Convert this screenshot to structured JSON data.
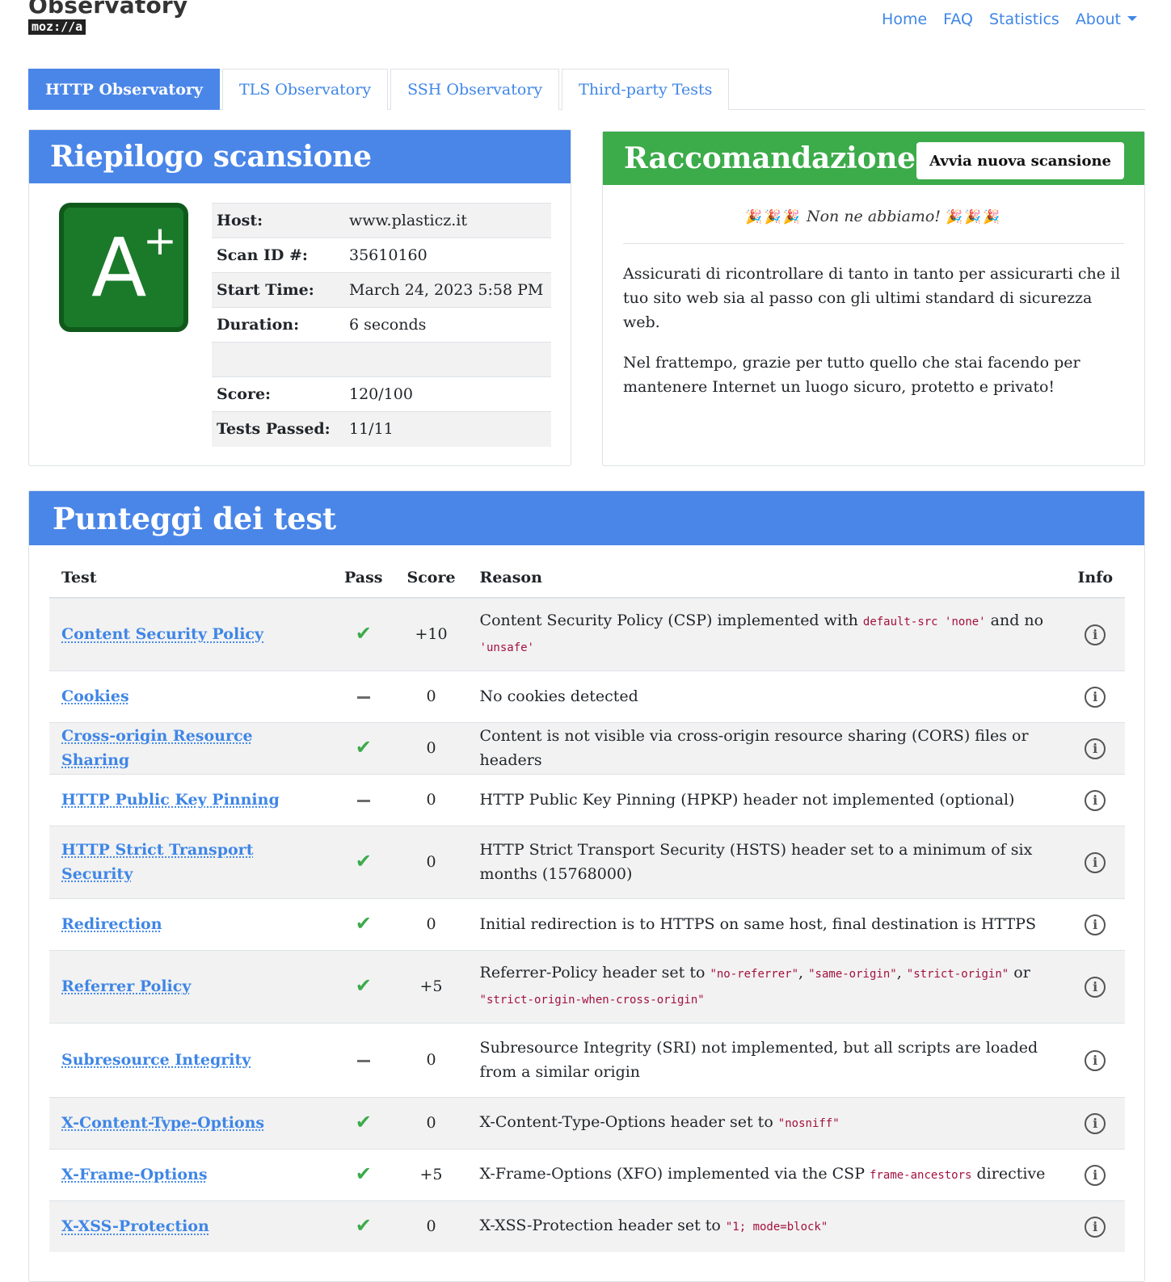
{
  "header": {
    "brand_title": "Observatory",
    "brand_logo": "moz://a",
    "nav": [
      "Home",
      "FAQ",
      "Statistics",
      "About"
    ]
  },
  "tabs": [
    "HTTP Observatory",
    "TLS Observatory",
    "SSH Observatory",
    "Third-party Tests"
  ],
  "summary": {
    "title": "Riepilogo scansione",
    "grade_letter": "A",
    "grade_mod": "+",
    "rows": [
      {
        "k": "Host:",
        "v": "www.plasticz.it"
      },
      {
        "k": "Scan ID #:",
        "v": "35610160"
      },
      {
        "k": "Start Time:",
        "v": "March 24, 2023 5:58 PM"
      },
      {
        "k": "Duration:",
        "v": "6 seconds"
      },
      {
        "k": "",
        "v": ""
      },
      {
        "k": "Score:",
        "v": "120/100"
      },
      {
        "k": "Tests Passed:",
        "v": "11/11"
      }
    ]
  },
  "recommendation": {
    "title": "Raccomandazione",
    "button": "Avvia nuova scansione",
    "party_left": "🎉🎉🎉",
    "headline": "Non ne abbiamo!",
    "party_right": "🎉🎉🎉",
    "p1": "Assicurati di ricontrollare di tanto in tanto per assicurarti che il tuo sito web sia al passo con gli ultimi standard di sicurezza web.",
    "p2": "Nel frattempo, grazie per tutto quello che stai facendo per mantenere Internet un luogo sicuro, protetto e privato!"
  },
  "tests": {
    "title": "Punteggi dei test",
    "columns": [
      "Test",
      "Pass",
      "Score",
      "Reason",
      "Info"
    ],
    "rows": [
      {
        "name": "Content Security Policy",
        "pass": "check",
        "score": "+10",
        "reason": [
          {
            "t": "Content Security Policy (CSP) implemented with "
          },
          {
            "c": "default-src 'none'"
          },
          {
            "t": " and no "
          },
          {
            "c": "'unsafe'"
          }
        ]
      },
      {
        "name": "Cookies",
        "pass": "dash",
        "score": "0",
        "reason": [
          {
            "t": "No cookies detected"
          }
        ]
      },
      {
        "name": "Cross-origin Resource Sharing",
        "pass": "check",
        "score": "0",
        "reason": [
          {
            "t": "Content is not visible via cross-origin resource sharing (CORS) files or headers"
          }
        ]
      },
      {
        "name": "HTTP Public Key Pinning",
        "pass": "dash",
        "score": "0",
        "reason": [
          {
            "t": "HTTP Public Key Pinning (HPKP) header not implemented (optional)"
          }
        ]
      },
      {
        "name": "HTTP Strict Transport Security",
        "pass": "check",
        "score": "0",
        "reason": [
          {
            "t": "HTTP Strict Transport Security (HSTS) header set to a minimum of six months (15768000)"
          }
        ]
      },
      {
        "name": "Redirection",
        "pass": "check",
        "score": "0",
        "reason": [
          {
            "t": "Initial redirection is to HTTPS on same host, final destination is HTTPS"
          }
        ]
      },
      {
        "name": "Referrer Policy",
        "pass": "check",
        "score": "+5",
        "reason": [
          {
            "t": "Referrer-Policy header set to "
          },
          {
            "c": "\"no-referrer\""
          },
          {
            "t": ", "
          },
          {
            "c": "\"same-origin\""
          },
          {
            "t": ", "
          },
          {
            "c": "\"strict-origin\""
          },
          {
            "t": " or "
          },
          {
            "c": "\"strict-origin-when-cross-origin\""
          }
        ]
      },
      {
        "name": "Subresource Integrity",
        "pass": "dash",
        "score": "0",
        "reason": [
          {
            "t": "Subresource Integrity (SRI) not implemented, but all scripts are loaded from a similar origin"
          }
        ]
      },
      {
        "name": "X-Content-Type-Options",
        "pass": "check",
        "score": "0",
        "reason": [
          {
            "t": "X-Content-Type-Options header set to "
          },
          {
            "c": "\"nosniff\""
          }
        ]
      },
      {
        "name": "X-Frame-Options",
        "pass": "check",
        "score": "+5",
        "reason": [
          {
            "t": "X-Frame-Options (XFO) implemented via the CSP "
          },
          {
            "c": "frame-ancestors"
          },
          {
            "t": " directive"
          }
        ]
      },
      {
        "name": "X-XSS-Protection",
        "pass": "check",
        "score": "0",
        "reason": [
          {
            "t": "X-XSS-Protection header set to "
          },
          {
            "c": "\"1; mode=block\""
          }
        ]
      }
    ],
    "row_heights": [
      90,
      64,
      64,
      64,
      90,
      64,
      90,
      92,
      64,
      64,
      64
    ]
  },
  "icons": {
    "pass": "checkmark-icon",
    "neutral": "dash-icon",
    "info": "info-circle-icon"
  },
  "colors": {
    "blue": "#4a86e8",
    "green": "#3cab4a",
    "grade": "#1b7a2a",
    "link": "#3f86e6"
  }
}
